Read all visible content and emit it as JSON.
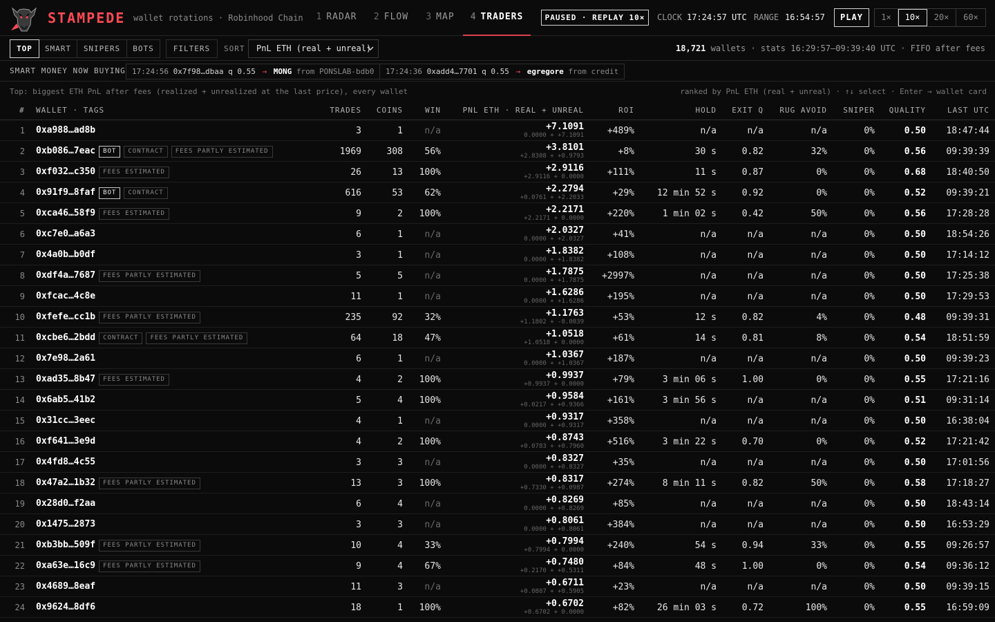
{
  "header": {
    "brand": "STAMPEDE",
    "subtitle": "wallet rotations · Robinhood Chain",
    "logo_icon": "bull-head-icon",
    "tabs": [
      {
        "num": "1",
        "label": "RADAR"
      },
      {
        "num": "2",
        "label": "FLOW"
      },
      {
        "num": "3",
        "label": "MAP"
      },
      {
        "num": "4",
        "label": "TRADERS",
        "active": true
      }
    ],
    "status": "PAUSED · REPLAY 10×",
    "clock_label": "CLOCK",
    "clock_value": "17:24:57 UTC",
    "range_label": "RANGE",
    "range_value": "16:54:57",
    "play_label": "PLAY",
    "speeds": [
      "1×",
      "10×",
      "20×",
      "60×"
    ],
    "active_speed": "10×"
  },
  "filters": {
    "tabs": [
      "TOP",
      "SMART",
      "SNIPERS",
      "BOTS"
    ],
    "active_tab": "TOP",
    "filters_label": "FILTERS",
    "sort_label": "SORT",
    "sort_value": "PnL ETH (real + unreal)",
    "wallet_count": "18,721",
    "stats_text": "wallets · stats 16:29:57–09:39:40 UTC · FIFO after fees"
  },
  "smart_money": {
    "label": "SMART MONEY NOW BUYING",
    "items": [
      {
        "time": "17:24:56",
        "wallet": "0x7f98…dbaa",
        "q": "q 0.55",
        "symbol": "MONG",
        "from": "from",
        "source": "PONSLAB-bdb0"
      },
      {
        "time": "17:24:36",
        "wallet": "0xadd4…7701",
        "q": "q 0.55",
        "symbol": "egregore",
        "from": "from",
        "source": "credit"
      }
    ]
  },
  "hint": {
    "left": "Top: biggest ETH PnL after fees (realized + unrealized at the last price), every wallet",
    "right": "ranked by PnL ETH (real + unreal) · ↑↓ select · Enter → wallet card"
  },
  "columns": {
    "idx": "#",
    "wallet": "WALLET · TAGS",
    "trades": "TRADES",
    "coins": "COINS",
    "win": "WIN",
    "pnl": "PNL ETH · REAL + UNREAL",
    "roi": "ROI",
    "hold": "HOLD",
    "exit": "EXIT Q",
    "rug": "RUG AVOID",
    "sniper": "SNIPER",
    "quality": "QUALITY",
    "last": "LAST UTC"
  },
  "rows": [
    {
      "idx": "1",
      "wallet": "0xa988…ad8b",
      "tags": [],
      "trades": "3",
      "coins": "1",
      "win": "n/a",
      "pnl": "+7.1091",
      "pnl_sub": "0.0000 + +7.1091",
      "roi": "+489%",
      "hold": "n/a",
      "exit": "n/a",
      "rug": "n/a",
      "sniper": "0%",
      "quality": "0.50",
      "last": "18:47:44"
    },
    {
      "idx": "2",
      "wallet": "0xb086…7eac",
      "tags": [
        "BOT",
        "CONTRACT",
        "FEES PARTLY ESTIMATED"
      ],
      "trades": "1969",
      "coins": "308",
      "win": "56%",
      "pnl": "+3.8101",
      "pnl_sub": "+2.8308 + +0.9793",
      "roi": "+8%",
      "hold": "30 s",
      "exit": "0.82",
      "rug": "32%",
      "sniper": "0%",
      "quality": "0.56",
      "last": "09:39:39"
    },
    {
      "idx": "3",
      "wallet": "0xf032…c350",
      "tags": [
        "FEES ESTIMATED"
      ],
      "trades": "26",
      "coins": "13",
      "win": "100%",
      "pnl": "+2.9116",
      "pnl_sub": "+2.9116 + 0.0000",
      "roi": "+111%",
      "hold": "11 s",
      "exit": "0.87",
      "rug": "0%",
      "sniper": "0%",
      "quality": "0.68",
      "last": "18:40:50"
    },
    {
      "idx": "4",
      "wallet": "0x91f9…8faf",
      "tags": [
        "BOT",
        "CONTRACT"
      ],
      "trades": "616",
      "coins": "53",
      "win": "62%",
      "pnl": "+2.2794",
      "pnl_sub": "+0.0761 + +2.2033",
      "roi": "+29%",
      "hold": "12 min 52 s",
      "exit": "0.92",
      "rug": "0%",
      "sniper": "0%",
      "quality": "0.52",
      "last": "09:39:21"
    },
    {
      "idx": "5",
      "wallet": "0xca46…58f9",
      "tags": [
        "FEES ESTIMATED"
      ],
      "trades": "9",
      "coins": "2",
      "win": "100%",
      "pnl": "+2.2171",
      "pnl_sub": "+2.2171 + 0.0000",
      "roi": "+220%",
      "hold": "1 min 02 s",
      "exit": "0.42",
      "rug": "50%",
      "sniper": "0%",
      "quality": "0.56",
      "last": "17:28:28"
    },
    {
      "idx": "6",
      "wallet": "0xc7e0…a6a3",
      "tags": [],
      "trades": "6",
      "coins": "1",
      "win": "n/a",
      "pnl": "+2.0327",
      "pnl_sub": "0.0000 + +2.0327",
      "roi": "+41%",
      "hold": "n/a",
      "exit": "n/a",
      "rug": "n/a",
      "sniper": "0%",
      "quality": "0.50",
      "last": "18:54:26"
    },
    {
      "idx": "7",
      "wallet": "0x4a0b…b0df",
      "tags": [],
      "trades": "3",
      "coins": "1",
      "win": "n/a",
      "pnl": "+1.8382",
      "pnl_sub": "0.0000 + +1.8382",
      "roi": "+108%",
      "hold": "n/a",
      "exit": "n/a",
      "rug": "n/a",
      "sniper": "0%",
      "quality": "0.50",
      "last": "17:14:12"
    },
    {
      "idx": "8",
      "wallet": "0xdf4a…7687",
      "tags": [
        "FEES PARTLY ESTIMATED"
      ],
      "trades": "5",
      "coins": "5",
      "win": "n/a",
      "pnl": "+1.7875",
      "pnl_sub": "0.0000 + +1.7875",
      "roi": "+2997%",
      "hold": "n/a",
      "exit": "n/a",
      "rug": "n/a",
      "sniper": "0%",
      "quality": "0.50",
      "last": "17:25:38"
    },
    {
      "idx": "9",
      "wallet": "0xfcac…4c8e",
      "tags": [],
      "trades": "11",
      "coins": "1",
      "win": "n/a",
      "pnl": "+1.6286",
      "pnl_sub": "0.0000 + +1.6286",
      "roi": "+195%",
      "hold": "n/a",
      "exit": "n/a",
      "rug": "n/a",
      "sniper": "0%",
      "quality": "0.50",
      "last": "17:29:53"
    },
    {
      "idx": "10",
      "wallet": "0xfefe…cc1b",
      "tags": [
        "FEES PARTLY ESTIMATED"
      ],
      "trades": "235",
      "coins": "92",
      "win": "32%",
      "pnl": "+1.1763",
      "pnl_sub": "+1.1802 + -0.0039",
      "roi": "+53%",
      "hold": "12 s",
      "exit": "0.82",
      "rug": "4%",
      "sniper": "0%",
      "quality": "0.48",
      "last": "09:39:31"
    },
    {
      "idx": "11",
      "wallet": "0xcbe6…2bdd",
      "tags": [
        "CONTRACT",
        "FEES PARTLY ESTIMATED"
      ],
      "trades": "64",
      "coins": "18",
      "win": "47%",
      "pnl": "+1.0518",
      "pnl_sub": "+1.0518 + 0.0000",
      "roi": "+61%",
      "hold": "14 s",
      "exit": "0.81",
      "rug": "8%",
      "sniper": "0%",
      "quality": "0.54",
      "last": "18:51:59"
    },
    {
      "idx": "12",
      "wallet": "0x7e98…2a61",
      "tags": [],
      "trades": "6",
      "coins": "1",
      "win": "n/a",
      "pnl": "+1.0367",
      "pnl_sub": "0.0000 + +1.0367",
      "roi": "+187%",
      "hold": "n/a",
      "exit": "n/a",
      "rug": "n/a",
      "sniper": "0%",
      "quality": "0.50",
      "last": "09:39:23"
    },
    {
      "idx": "13",
      "wallet": "0xad35…8b47",
      "tags": [
        "FEES ESTIMATED"
      ],
      "trades": "4",
      "coins": "2",
      "win": "100%",
      "pnl": "+0.9937",
      "pnl_sub": "+0.9937 + 0.0000",
      "roi": "+79%",
      "hold": "3 min 06 s",
      "exit": "1.00",
      "rug": "0%",
      "sniper": "0%",
      "quality": "0.55",
      "last": "17:21:16"
    },
    {
      "idx": "14",
      "wallet": "0x6ab5…41b2",
      "tags": [],
      "trades": "5",
      "coins": "4",
      "win": "100%",
      "pnl": "+0.9584",
      "pnl_sub": "+0.0217 + +0.9366",
      "roi": "+161%",
      "hold": "3 min 56 s",
      "exit": "n/a",
      "rug": "n/a",
      "sniper": "0%",
      "quality": "0.51",
      "last": "09:31:14"
    },
    {
      "idx": "15",
      "wallet": "0x31cc…3eec",
      "tags": [],
      "trades": "4",
      "coins": "1",
      "win": "n/a",
      "pnl": "+0.9317",
      "pnl_sub": "0.0000 + +0.9317",
      "roi": "+358%",
      "hold": "n/a",
      "exit": "n/a",
      "rug": "n/a",
      "sniper": "0%",
      "quality": "0.50",
      "last": "16:38:04"
    },
    {
      "idx": "16",
      "wallet": "0xf641…3e9d",
      "tags": [],
      "trades": "4",
      "coins": "2",
      "win": "100%",
      "pnl": "+0.8743",
      "pnl_sub": "+0.0783 + +0.7960",
      "roi": "+516%",
      "hold": "3 min 22 s",
      "exit": "0.70",
      "rug": "0%",
      "sniper": "0%",
      "quality": "0.52",
      "last": "17:21:42"
    },
    {
      "idx": "17",
      "wallet": "0x4fd8…4c55",
      "tags": [],
      "trades": "3",
      "coins": "3",
      "win": "n/a",
      "pnl": "+0.8327",
      "pnl_sub": "0.0000 + +0.8327",
      "roi": "+35%",
      "hold": "n/a",
      "exit": "n/a",
      "rug": "n/a",
      "sniper": "0%",
      "quality": "0.50",
      "last": "17:01:56"
    },
    {
      "idx": "18",
      "wallet": "0x47a2…1b32",
      "tags": [
        "FEES PARTLY ESTIMATED"
      ],
      "trades": "13",
      "coins": "3",
      "win": "100%",
      "pnl": "+0.8317",
      "pnl_sub": "+0.7330 + +0.0987",
      "roi": "+274%",
      "hold": "8 min 11 s",
      "exit": "0.82",
      "rug": "50%",
      "sniper": "0%",
      "quality": "0.58",
      "last": "17:18:27"
    },
    {
      "idx": "19",
      "wallet": "0x28d0…f2aa",
      "tags": [],
      "trades": "6",
      "coins": "4",
      "win": "n/a",
      "pnl": "+0.8269",
      "pnl_sub": "0.0000 + +0.8269",
      "roi": "+85%",
      "hold": "n/a",
      "exit": "n/a",
      "rug": "n/a",
      "sniper": "0%",
      "quality": "0.50",
      "last": "18:43:14"
    },
    {
      "idx": "20",
      "wallet": "0x1475…2873",
      "tags": [],
      "trades": "3",
      "coins": "3",
      "win": "n/a",
      "pnl": "+0.8061",
      "pnl_sub": "0.0000 + +0.8061",
      "roi": "+384%",
      "hold": "n/a",
      "exit": "n/a",
      "rug": "n/a",
      "sniper": "0%",
      "quality": "0.50",
      "last": "16:53:29"
    },
    {
      "idx": "21",
      "wallet": "0xb3bb…509f",
      "tags": [
        "FEES PARTLY ESTIMATED"
      ],
      "trades": "10",
      "coins": "4",
      "win": "33%",
      "pnl": "+0.7994",
      "pnl_sub": "+0.7994 + 0.0000",
      "roi": "+240%",
      "hold": "54 s",
      "exit": "0.94",
      "rug": "33%",
      "sniper": "0%",
      "quality": "0.55",
      "last": "09:26:57"
    },
    {
      "idx": "22",
      "wallet": "0xa63e…16c9",
      "tags": [
        "FEES PARTLY ESTIMATED"
      ],
      "trades": "9",
      "coins": "4",
      "win": "67%",
      "pnl": "+0.7480",
      "pnl_sub": "+0.2170 + +0.5311",
      "roi": "+84%",
      "hold": "48 s",
      "exit": "1.00",
      "rug": "0%",
      "sniper": "0%",
      "quality": "0.54",
      "last": "09:36:12"
    },
    {
      "idx": "23",
      "wallet": "0x4689…8eaf",
      "tags": [],
      "trades": "11",
      "coins": "3",
      "win": "n/a",
      "pnl": "+0.6711",
      "pnl_sub": "+0.0807 + +0.5905",
      "roi": "+23%",
      "hold": "n/a",
      "exit": "n/a",
      "rug": "n/a",
      "sniper": "0%",
      "quality": "0.50",
      "last": "09:39:15"
    },
    {
      "idx": "24",
      "wallet": "0x9624…8df6",
      "tags": [],
      "trades": "18",
      "coins": "1",
      "win": "100%",
      "pnl": "+0.6702",
      "pnl_sub": "+0.6702 + 0.0000",
      "roi": "+82%",
      "hold": "26 min 03 s",
      "exit": "0.72",
      "rug": "100%",
      "sniper": "0%",
      "quality": "0.55",
      "last": "16:59:09"
    }
  ],
  "colors": {
    "accent": "#ff4a55",
    "background": "#0b0b0b"
  }
}
